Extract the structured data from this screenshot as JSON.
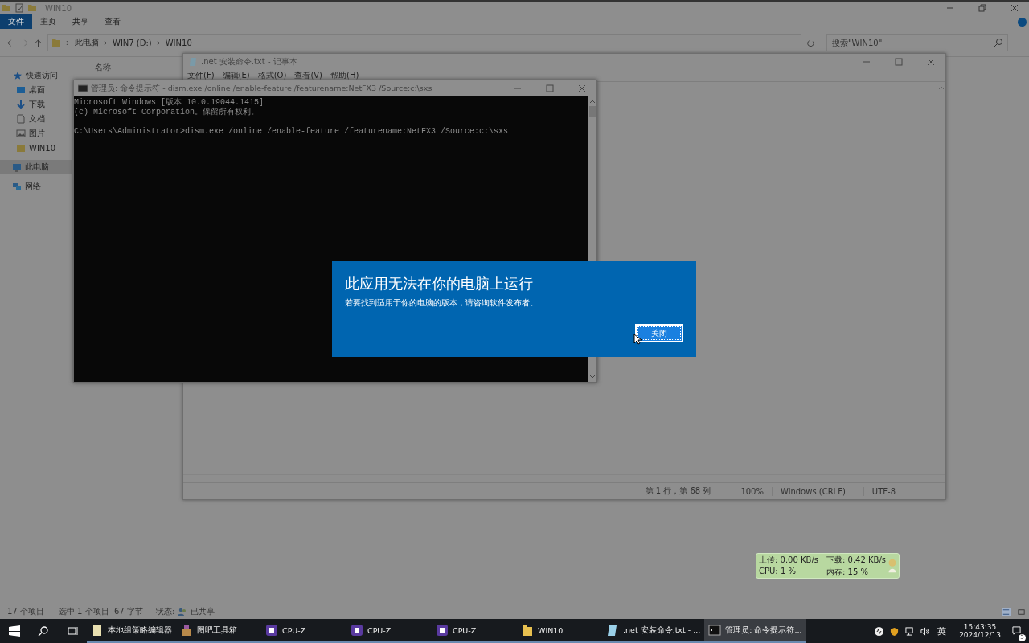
{
  "explorer": {
    "title": "WIN10",
    "ribbon_tabs": [
      {
        "label": "文件",
        "selected": true
      },
      {
        "label": "主页",
        "selected": false
      },
      {
        "label": "共享",
        "selected": false
      },
      {
        "label": "查看",
        "selected": false
      }
    ],
    "breadcrumb": [
      "此电脑",
      "WIN7 (D:)",
      "WIN10"
    ],
    "search": {
      "placeholder": "搜索\"WIN10\""
    },
    "column_header": "名称",
    "sidebar": [
      {
        "label": "快速访问",
        "kind": "star",
        "selected": false
      },
      {
        "label": "桌面",
        "kind": "desktop",
        "selected": false
      },
      {
        "label": "下载",
        "kind": "download",
        "selected": false
      },
      {
        "label": "文档",
        "kind": "document",
        "selected": false
      },
      {
        "label": "图片",
        "kind": "image",
        "selected": false
      },
      {
        "label": "WIN10",
        "kind": "folder",
        "selected": false
      },
      {
        "label": "此电脑",
        "kind": "computer",
        "selected": true
      },
      {
        "label": "网络",
        "kind": "network",
        "selected": false
      }
    ],
    "status_bar": {
      "count": "17 个项目",
      "selection": "选中 1 个项目  67 字节",
      "state_label": "状态:",
      "state": "已共享"
    }
  },
  "notepad": {
    "title": ".net 安装命令.txt - 记事本",
    "menu": [
      "文件(F)",
      "编辑(E)",
      "格式(O)",
      "查看(V)",
      "帮助(H)"
    ],
    "status": [
      "第 1 行，第 68 列",
      "100%",
      "Windows (CRLF)",
      "UTF-8"
    ]
  },
  "cmd": {
    "title": "管理员: 命令提示符 - dism.exe  /online /enable-feature /featurename:NetFX3 /Source:c:\\sxs",
    "blocks": [
      [
        "Microsoft Windows [版本 10.0.19044.1415]",
        "(c) Microsoft Corporation。保留所有权利。"
      ],
      [
        "C:\\Users\\Administrator>dism.exe /online /enable-feature /featurename:NetFX3 /Source:c:\\sxs"
      ]
    ]
  },
  "dialog": {
    "title": "此应用无法在你的电脑上运行",
    "message": "若要找到适用于你的电脑的版本，请咨询软件发布者。",
    "button": "关闭"
  },
  "net_meter": {
    "upload": "上传: 0.00 KB/s",
    "download": "下载: 0.42 KB/s",
    "cpu": "CPU: 1 %",
    "memory": "内存: 15 %"
  },
  "taskbar": {
    "items": [
      {
        "label": "本地组策略编辑器",
        "kind": "policy",
        "selected": false
      },
      {
        "label": "图吧工具箱",
        "kind": "toolbox",
        "selected": false
      },
      {
        "label": "CPU-Z",
        "kind": "cpuz",
        "selected": false
      },
      {
        "label": "CPU-Z",
        "kind": "cpuz",
        "selected": false
      },
      {
        "label": "CPU-Z",
        "kind": "cpuz",
        "selected": false
      },
      {
        "label": "WIN10",
        "kind": "folder",
        "selected": false
      },
      {
        "label": ".net 安装命令.txt - ...",
        "kind": "notepad",
        "selected": false
      },
      {
        "label": "管理员: 命令提示符...",
        "kind": "cmd",
        "selected": true
      }
    ],
    "ime": "英",
    "time": "15:43:35",
    "date": "2024/12/13",
    "notifications": "3"
  }
}
